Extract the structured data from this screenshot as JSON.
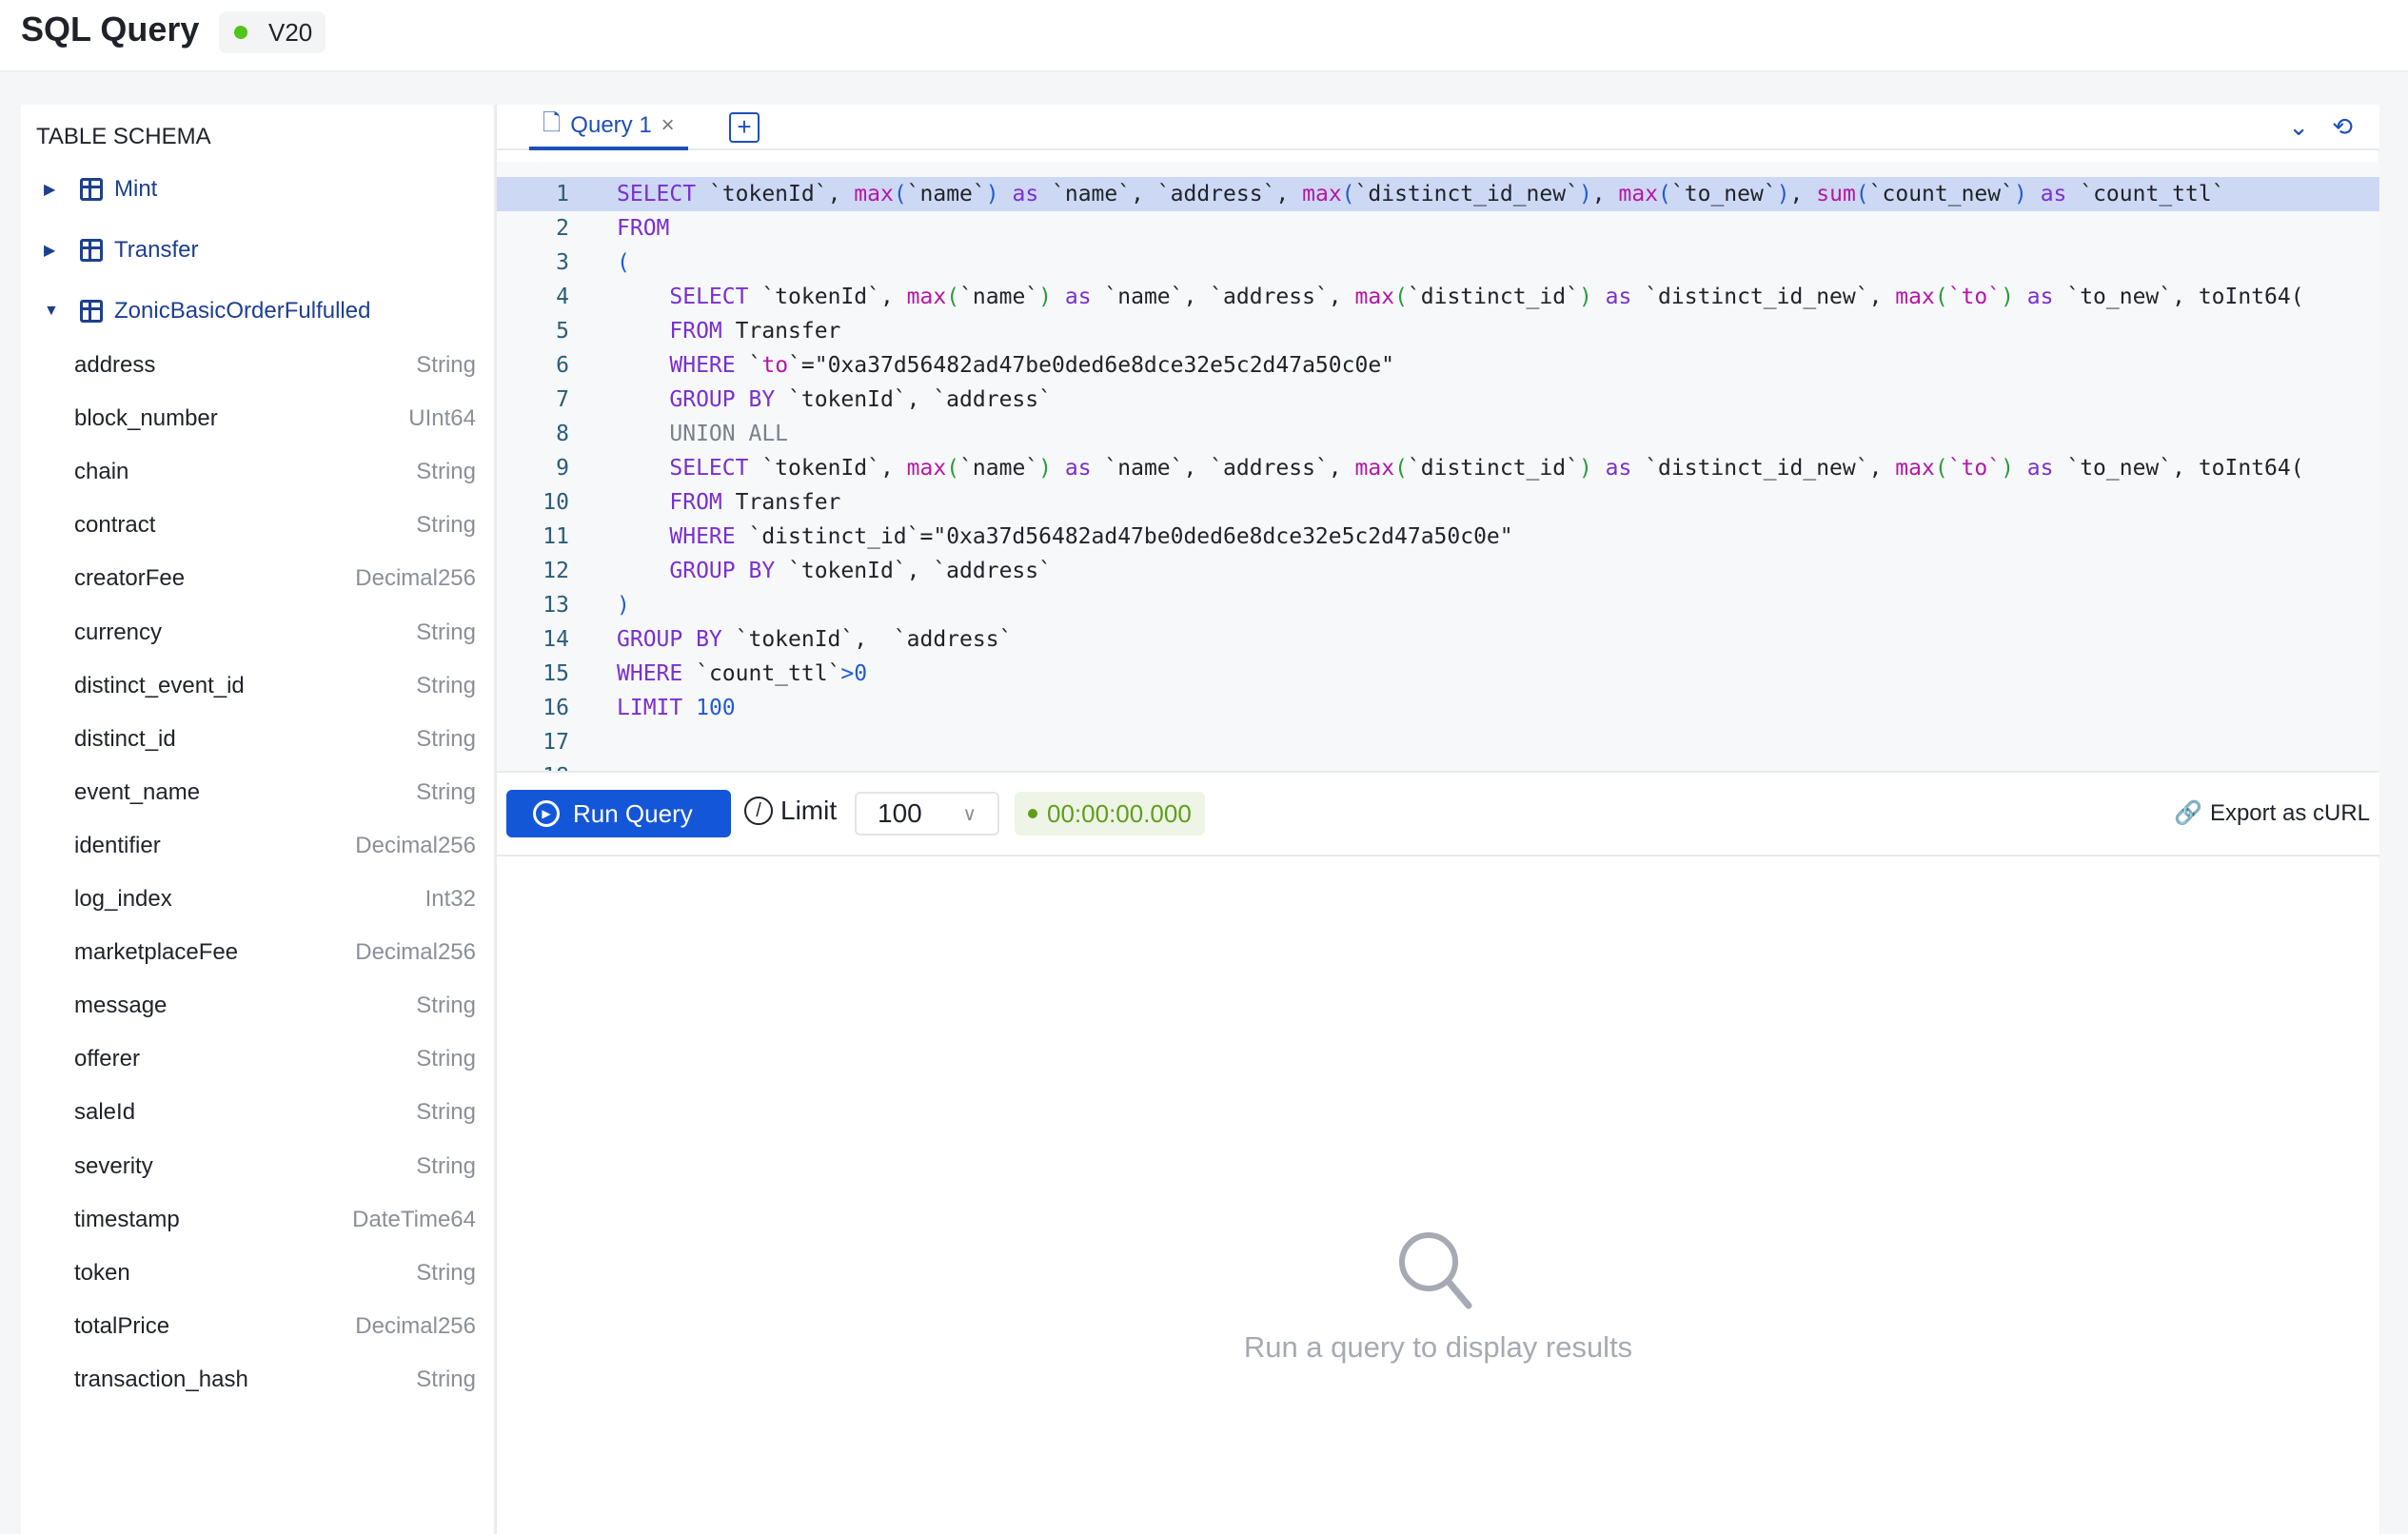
{
  "header": {
    "title": "SQL Query",
    "version": "V20",
    "status_color": "#52c41a"
  },
  "sidebar": {
    "title": "TABLE SCHEMA",
    "tables": [
      {
        "name": "Mint",
        "expanded": false
      },
      {
        "name": "Transfer",
        "expanded": false
      },
      {
        "name": "ZonicBasicOrderFulfulled",
        "expanded": true
      }
    ],
    "fields": [
      {
        "name": "address",
        "type": "String"
      },
      {
        "name": "block_number",
        "type": "UInt64"
      },
      {
        "name": "chain",
        "type": "String"
      },
      {
        "name": "contract",
        "type": "String"
      },
      {
        "name": "creatorFee",
        "type": "Decimal256"
      },
      {
        "name": "currency",
        "type": "String"
      },
      {
        "name": "distinct_event_id",
        "type": "String"
      },
      {
        "name": "distinct_id",
        "type": "String"
      },
      {
        "name": "event_name",
        "type": "String"
      },
      {
        "name": "identifier",
        "type": "Decimal256"
      },
      {
        "name": "log_index",
        "type": "Int32"
      },
      {
        "name": "marketplaceFee",
        "type": "Decimal256"
      },
      {
        "name": "message",
        "type": "String"
      },
      {
        "name": "offerer",
        "type": "String"
      },
      {
        "name": "saleId",
        "type": "String"
      },
      {
        "name": "severity",
        "type": "String"
      },
      {
        "name": "timestamp",
        "type": "DateTime64"
      },
      {
        "name": "token",
        "type": "String"
      },
      {
        "name": "totalPrice",
        "type": "Decimal256"
      },
      {
        "name": "transaction_hash",
        "type": "String"
      }
    ]
  },
  "editor": {
    "tab_label": "Query 1",
    "lines": [
      [
        [
          "SELECT",
          "kw"
        ],
        [
          " `tokenId`, ",
          "plain"
        ],
        [
          "max",
          "fn"
        ],
        [
          "(",
          "p1"
        ],
        [
          "`name`",
          "plain"
        ],
        [
          ")",
          "p1"
        ],
        [
          " as ",
          "kw"
        ],
        [
          "`name`, `address`, ",
          "plain"
        ],
        [
          "max",
          "fn"
        ],
        [
          "(",
          "p1"
        ],
        [
          "`distinct_id_new`",
          "plain"
        ],
        [
          ")",
          "p1"
        ],
        [
          ", ",
          "plain"
        ],
        [
          "max",
          "fn"
        ],
        [
          "(",
          "p1"
        ],
        [
          "`to_new`",
          "plain"
        ],
        [
          ")",
          "p1"
        ],
        [
          ", ",
          "plain"
        ],
        [
          "sum",
          "fn"
        ],
        [
          "(",
          "p1"
        ],
        [
          "`count_new`",
          "plain"
        ],
        [
          ")",
          "p1"
        ],
        [
          " as ",
          "kw"
        ],
        [
          "`count_ttl`",
          "plain"
        ]
      ],
      [
        [
          "FROM",
          "kw"
        ]
      ],
      [
        [
          "(",
          "p1"
        ]
      ],
      [
        [
          "    ",
          "plain"
        ],
        [
          "SELECT",
          "kw"
        ],
        [
          " `tokenId`, ",
          "plain"
        ],
        [
          "max",
          "fn"
        ],
        [
          "(",
          "p2"
        ],
        [
          "`name`",
          "plain"
        ],
        [
          ")",
          "p2"
        ],
        [
          " as ",
          "kw"
        ],
        [
          "`name`, `address`, ",
          "plain"
        ],
        [
          "max",
          "fn"
        ],
        [
          "(",
          "p2"
        ],
        [
          "`distinct_id`",
          "plain"
        ],
        [
          ")",
          "p2"
        ],
        [
          " as ",
          "kw"
        ],
        [
          "`distinct_id_new`, ",
          "plain"
        ],
        [
          "max",
          "fn"
        ],
        [
          "(",
          "p2"
        ],
        [
          "`to`",
          "fn"
        ],
        [
          ")",
          "p2"
        ],
        [
          " as ",
          "kw"
        ],
        [
          "`to_new`, toInt64(",
          "plain"
        ]
      ],
      [
        [
          "    ",
          "plain"
        ],
        [
          "FROM",
          "kw"
        ],
        [
          " Transfer",
          "plain"
        ]
      ],
      [
        [
          "    ",
          "plain"
        ],
        [
          "WHERE",
          "kw"
        ],
        [
          " `",
          "plain"
        ],
        [
          "to",
          "fn"
        ],
        [
          "`=\"0xa37d56482ad47be0ded6e8dce32e5c2d47a50c0e\"",
          "plain"
        ]
      ],
      [
        [
          "    ",
          "plain"
        ],
        [
          "GROUP BY",
          "kw"
        ],
        [
          " `tokenId`, `address`",
          "plain"
        ]
      ],
      [
        [
          "    ",
          "plain"
        ],
        [
          "UNION ALL",
          "gray"
        ]
      ],
      [
        [
          "    ",
          "plain"
        ],
        [
          "SELECT",
          "kw"
        ],
        [
          " `tokenId`, ",
          "plain"
        ],
        [
          "max",
          "fn"
        ],
        [
          "(",
          "p2"
        ],
        [
          "`name`",
          "plain"
        ],
        [
          ")",
          "p2"
        ],
        [
          " as ",
          "kw"
        ],
        [
          "`name`, `address`, ",
          "plain"
        ],
        [
          "max",
          "fn"
        ],
        [
          "(",
          "p2"
        ],
        [
          "`distinct_id`",
          "plain"
        ],
        [
          ")",
          "p2"
        ],
        [
          " as ",
          "kw"
        ],
        [
          "`distinct_id_new`, ",
          "plain"
        ],
        [
          "max",
          "fn"
        ],
        [
          "(",
          "p2"
        ],
        [
          "`to`",
          "fn"
        ],
        [
          ")",
          "p2"
        ],
        [
          " as ",
          "kw"
        ],
        [
          "`to_new`, toInt64(",
          "plain"
        ]
      ],
      [
        [
          "    ",
          "plain"
        ],
        [
          "FROM",
          "kw"
        ],
        [
          " Transfer",
          "plain"
        ]
      ],
      [
        [
          "    ",
          "plain"
        ],
        [
          "WHERE",
          "kw"
        ],
        [
          " `distinct_id`=\"0xa37d56482ad47be0ded6e8dce32e5c2d47a50c0e\"",
          "plain"
        ]
      ],
      [
        [
          "    ",
          "plain"
        ],
        [
          "GROUP BY",
          "kw"
        ],
        [
          " `tokenId`, `address`",
          "plain"
        ]
      ],
      [
        [
          ")",
          "p1"
        ]
      ],
      [
        [
          "GROUP BY",
          "kw"
        ],
        [
          " `tokenId`,  `address`",
          "plain"
        ]
      ],
      [
        [
          "WHERE",
          "kw"
        ],
        [
          " `count_ttl`",
          "plain"
        ],
        [
          ">0",
          "num"
        ]
      ],
      [
        [
          "LIMIT",
          "kw"
        ],
        [
          " ",
          "plain"
        ],
        [
          "100",
          "num"
        ]
      ],
      [],
      []
    ]
  },
  "toolbar": {
    "run_label": "Run Query",
    "limit_label": "Limit",
    "limit_value": "100",
    "timer": "00:00:00.000",
    "export_label": "Export as cURL",
    "accent": "#1456d8"
  },
  "results": {
    "empty_text": "Run a query to display results"
  }
}
